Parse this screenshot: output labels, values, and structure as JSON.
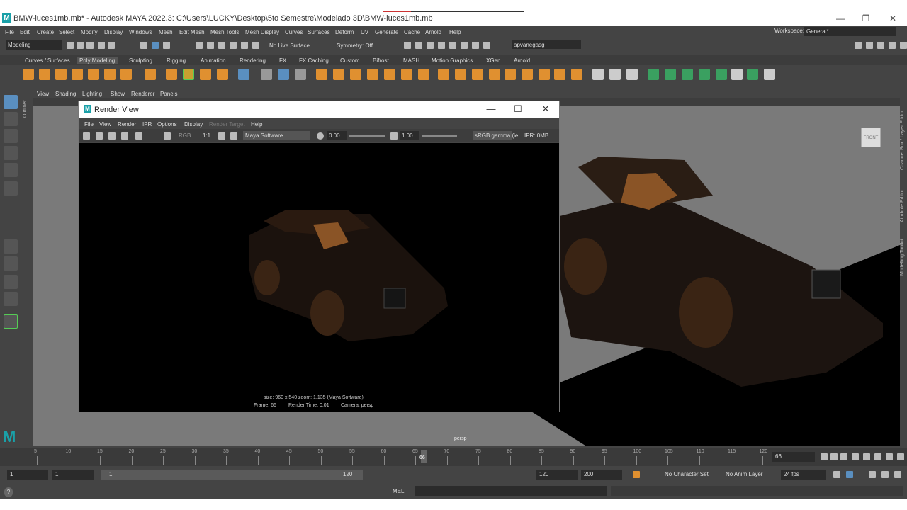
{
  "title_bar": {
    "text": "BMW-luces1mb.mb* - Autodesk MAYA 2022.3: C:\\Users\\LUCKY\\Desktop\\5to Semestre\\Modelado 3D\\BMW-luces1mb.mb",
    "logo": "M",
    "minimize": "—",
    "restore": "❐",
    "close": "✕"
  },
  "menu": [
    "File",
    "Edit",
    "Create",
    "Select",
    "Modify",
    "Display",
    "Windows",
    "Mesh",
    "Edit Mesh",
    "Mesh Tools",
    "Mesh Display",
    "Curves",
    "Surfaces",
    "Deform",
    "UV",
    "Generate",
    "Cache",
    "Arnold",
    "Help"
  ],
  "workspace": {
    "label": "Workspace:",
    "value": "General*"
  },
  "status_line": {
    "mode": "Modeling",
    "live_surface": "No Live Surface",
    "symmetry": "Symmetry: Off",
    "user": "apvanegasg"
  },
  "shelf_tabs": [
    "Curves / Surfaces",
    "Poly Modeling",
    "Sculpting",
    "Rigging",
    "Animation",
    "Rendering",
    "FX",
    "FX Caching",
    "Custom",
    "Bifrost",
    "MASH",
    "Motion Graphics",
    "XGen",
    "Arnold"
  ],
  "shelf_active": "Poly Modeling",
  "viewport_menu": [
    "View",
    "Shading",
    "Lighting",
    "Show",
    "Renderer",
    "Panels"
  ],
  "outliner_label": "Outliner",
  "right_labels": [
    "Channel Box / Layer Editor",
    "Attribute Editor",
    "Modelling Toolkit"
  ],
  "viewcube_label": "FRONT",
  "viewport_camera": "persp",
  "render_view": {
    "title": "Render View",
    "menu": [
      "File",
      "View",
      "Render",
      "IPR",
      "Options",
      "Display",
      "Render Target",
      "Help"
    ],
    "ratio": "1:1",
    "renderer": "Maya Software",
    "exposure": "0.00",
    "gamma": "1.00",
    "colorspace": "sRGB gamma (ie",
    "ipr": "IPR: 0MB",
    "info_line1": "size: 960 x 540 zoom: 1.135      (Maya Software)",
    "info_frame": "Frame: 66",
    "info_time": "Render Time: 0:01",
    "info_camera": "Camera: persp"
  },
  "timeline": {
    "ticks": [
      "5",
      "10",
      "15",
      "20",
      "25",
      "30",
      "35",
      "40",
      "45",
      "50",
      "55",
      "60",
      "65",
      "70",
      "75",
      "80",
      "85",
      "90",
      "95",
      "100",
      "105",
      "110",
      "115",
      "120"
    ],
    "current_frame": "66",
    "current_field": "66"
  },
  "range": {
    "start": "1",
    "start2": "1",
    "slider_start": "1",
    "slider_end": "120",
    "end": "120",
    "end2": "200",
    "character_set": "No Character Set",
    "anim_layer": "No Anim Layer",
    "fps": "24 fps"
  },
  "command_line": {
    "lang": "MEL",
    "help_icon": "?"
  }
}
